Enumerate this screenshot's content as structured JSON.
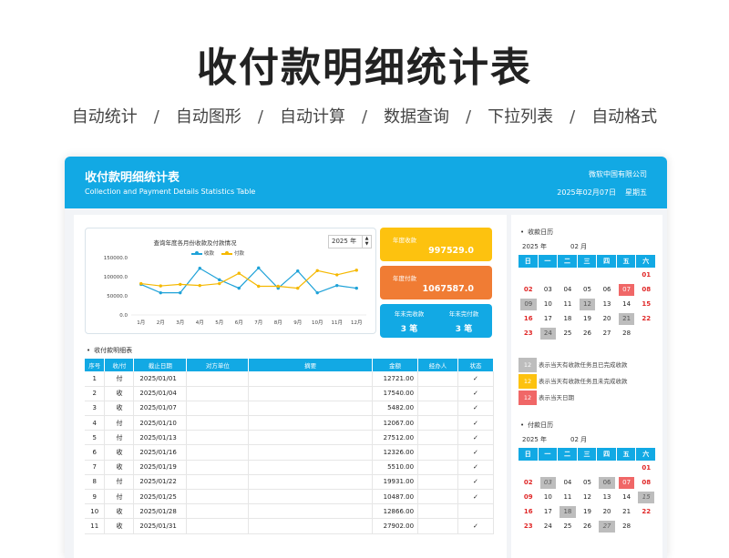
{
  "hero": {
    "title": "收付款明细统计表",
    "features": [
      "自动统计",
      "自动图形",
      "自动计算",
      "数据查询",
      "下拉列表",
      "自动格式"
    ],
    "separator": "/"
  },
  "header": {
    "title": "收付款明细统计表",
    "subtitle": "Collection and Payment Details Statistics Table",
    "company": "微软中国有限公司",
    "date": "2025年02月07日",
    "weekday": "星期五"
  },
  "chart": {
    "title": "查询年度各月份收款及付款情况",
    "year_value": "2025",
    "year_unit": "年"
  },
  "chart_data": {
    "type": "line",
    "title": "查询年度各月份收款及付款情况",
    "categories": [
      "1月",
      "2月",
      "3月",
      "4月",
      "5月",
      "6月",
      "7月",
      "8月",
      "9月",
      "10月",
      "11月",
      "12月"
    ],
    "ylim": [
      0,
      150000
    ],
    "yticks": [
      "0.0",
      "50000.0",
      "100000.0",
      "150000.0"
    ],
    "legend_position": "top",
    "series": [
      {
        "name": "收款",
        "color": "#1fa2d8",
        "values": [
          80000,
          58000,
          58000,
          122000,
          92000,
          70000,
          123000,
          70000,
          115000,
          58000,
          77000,
          70000
        ]
      },
      {
        "name": "付款",
        "color": "#f5b800",
        "values": [
          82000,
          76000,
          80000,
          77000,
          82000,
          109000,
          75000,
          75000,
          70000,
          116000,
          105000,
          117000
        ]
      }
    ]
  },
  "kpis": {
    "receipt_label": "年度收款",
    "receipt_value": "997529.0",
    "payment_label": "年度付款",
    "payment_value": "1067587.0",
    "unfinished_receipt_label": "年未完收款",
    "unfinished_receipt_value": "3 笔",
    "unfinished_payment_label": "年未完付款",
    "unfinished_payment_value": "3 笔"
  },
  "detail": {
    "section_title": "收付款明细表",
    "columns": [
      "序号",
      "收/付",
      "截止日期",
      "对方单位",
      "摘要",
      "金额",
      "经办人",
      "状态"
    ],
    "rows": [
      [
        "1",
        "付",
        "2025/01/01",
        "",
        "",
        "12721.00",
        "",
        "✓"
      ],
      [
        "2",
        "收",
        "2025/01/04",
        "",
        "",
        "17540.00",
        "",
        "✓"
      ],
      [
        "3",
        "收",
        "2025/01/07",
        "",
        "",
        "5482.00",
        "",
        "✓"
      ],
      [
        "4",
        "付",
        "2025/01/10",
        "",
        "",
        "12067.00",
        "",
        "✓"
      ],
      [
        "5",
        "付",
        "2025/01/13",
        "",
        "",
        "27512.00",
        "",
        "✓"
      ],
      [
        "6",
        "收",
        "2025/01/16",
        "",
        "",
        "12326.00",
        "",
        "✓"
      ],
      [
        "7",
        "收",
        "2025/01/19",
        "",
        "",
        "5510.00",
        "",
        "✓"
      ],
      [
        "8",
        "付",
        "2025/01/22",
        "",
        "",
        "19931.00",
        "",
        "✓"
      ],
      [
        "9",
        "付",
        "2025/01/25",
        "",
        "",
        "10487.00",
        "",
        "✓"
      ],
      [
        "10",
        "收",
        "2025/01/28",
        "",
        "",
        "12866.00",
        "",
        ""
      ],
      [
        "11",
        "收",
        "2025/01/31",
        "",
        "",
        "27902.00",
        "",
        "✓"
      ]
    ]
  },
  "receipt_calendar": {
    "title": "收款日历",
    "year": "2025 年",
    "month": "02 月",
    "weekdays": [
      "日",
      "一",
      "二",
      "三",
      "四",
      "五",
      "六"
    ],
    "cells": [
      {
        "t": ""
      },
      {
        "t": ""
      },
      {
        "t": ""
      },
      {
        "t": ""
      },
      {
        "t": ""
      },
      {
        "t": ""
      },
      {
        "t": "01",
        "s": "red"
      },
      {
        "t": "02",
        "s": "red"
      },
      {
        "t": "03"
      },
      {
        "t": "04"
      },
      {
        "t": "05"
      },
      {
        "t": "06"
      },
      {
        "t": "07",
        "s": "rb"
      },
      {
        "t": "08",
        "s": "red"
      },
      {
        "t": "09",
        "s": "g"
      },
      {
        "t": "10"
      },
      {
        "t": "11"
      },
      {
        "t": "12",
        "s": "g"
      },
      {
        "t": "13"
      },
      {
        "t": "14"
      },
      {
        "t": "15",
        "s": "red"
      },
      {
        "t": "16",
        "s": "red"
      },
      {
        "t": "17"
      },
      {
        "t": "18"
      },
      {
        "t": "19"
      },
      {
        "t": "20"
      },
      {
        "t": "21",
        "s": "g"
      },
      {
        "t": "22",
        "s": "red"
      },
      {
        "t": "23",
        "s": "red"
      },
      {
        "t": "24",
        "s": "g"
      },
      {
        "t": "25"
      },
      {
        "t": "26"
      },
      {
        "t": "27"
      },
      {
        "t": "28"
      },
      {
        "t": ""
      }
    ]
  },
  "calendar_legend": [
    {
      "box": "12",
      "color": "#bdbdbd",
      "text": "表示当天有收款任务且已完成收款"
    },
    {
      "box": "12",
      "color": "#fdc20f",
      "text": "表示当天有收款任务且未完成收款"
    },
    {
      "box": "12",
      "color": "#f06767",
      "text": "表示当天日期"
    }
  ],
  "payment_calendar": {
    "title": "付款日历",
    "year": "2025 年",
    "month": "02 月",
    "weekdays": [
      "日",
      "一",
      "二",
      "三",
      "四",
      "五",
      "六"
    ],
    "cells": [
      {
        "t": ""
      },
      {
        "t": ""
      },
      {
        "t": ""
      },
      {
        "t": ""
      },
      {
        "t": ""
      },
      {
        "t": ""
      },
      {
        "t": "01",
        "s": "red"
      },
      {
        "t": "02",
        "s": "red"
      },
      {
        "t": "03",
        "s": "gi"
      },
      {
        "t": "04"
      },
      {
        "t": "05"
      },
      {
        "t": "06",
        "s": "g"
      },
      {
        "t": "07",
        "s": "rb"
      },
      {
        "t": "08",
        "s": "red"
      },
      {
        "t": "09",
        "s": "red"
      },
      {
        "t": "10"
      },
      {
        "t": "11"
      },
      {
        "t": "12"
      },
      {
        "t": "13"
      },
      {
        "t": "14"
      },
      {
        "t": "15",
        "s": "gi"
      },
      {
        "t": "16",
        "s": "red"
      },
      {
        "t": "17"
      },
      {
        "t": "18",
        "s": "g"
      },
      {
        "t": "19"
      },
      {
        "t": "20"
      },
      {
        "t": "21"
      },
      {
        "t": "22",
        "s": "red"
      },
      {
        "t": "23",
        "s": "red"
      },
      {
        "t": "24"
      },
      {
        "t": "25"
      },
      {
        "t": "26"
      },
      {
        "t": "27",
        "s": "gi"
      },
      {
        "t": "28"
      },
      {
        "t": ""
      }
    ]
  }
}
